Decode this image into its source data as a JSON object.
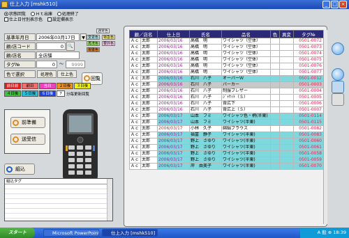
{
  "window": {
    "title": "仕上入力 [mshk510]"
  },
  "options": {
    "radio1": "状態回覧",
    "radio2": "Ｈｔ出庫",
    "radio3": "処理終了",
    "checkbox1": "仕上日付別表示色",
    "checkbox2": "設定欄表示"
  },
  "status_labels": {
    "s1": "通常色",
    "s2": "変更色",
    "s3": "特急色",
    "s4": "再洗色",
    "s5": "要外色",
    "s6": "現書色"
  },
  "form": {
    "base_date_label": "基準年月日",
    "base_date_value": "2006年03月17日",
    "store_code_label": "顧/店コード",
    "store_code_value": "0",
    "store_name_label": "顧/店名",
    "store_name_value": "全店舗",
    "tag_label": "タグ№",
    "tag_from": "0",
    "tag_sep": "～",
    "tag_to": "9999",
    "color_select_label": "色で選択",
    "process_color_label": "処理色",
    "finish_color_label": "仕上色",
    "tuning_label": "回覧"
  },
  "color_buttons": [
    "前日前",
    "前日",
    "当日",
    "２日後",
    "３日後",
    "４日後",
    "５日後",
    "６日後",
    "7"
  ],
  "refresh_note": "分毎更新回覧",
  "buttons": {
    "prev": "前準備",
    "send": "送受信",
    "assemble": "組込"
  },
  "tag_list": {
    "header": "組込タグ"
  },
  "grid": {
    "headers": [
      "顧／店名",
      "仕上日",
      "氏名",
      "品名",
      "色",
      "異変",
      "タグ№"
    ],
    "rows": [
      {
        "cust": "Ａｃ",
        "store": "太郎",
        "date": "2006/03/16",
        "name": "高橋　明",
        "item": "ワイシャツ（空体）",
        "color": "",
        "abn": "",
        "tag": "0501-0072",
        "style": "white"
      },
      {
        "cust": "Ａｃ",
        "store": "太郎",
        "date": "2006/03/16",
        "name": "高橋　明",
        "item": "ワイシャツ（空体）",
        "color": "",
        "abn": "",
        "tag": "0501-0073",
        "style": "white"
      },
      {
        "cust": "Ａｃ",
        "store": "太郎",
        "date": "2006/03/16",
        "name": "高橋　明",
        "item": "ワイシャツ（空体）",
        "color": "",
        "abn": "",
        "tag": "0501-0074",
        "style": "white"
      },
      {
        "cust": "Ａｃ",
        "store": "太郎",
        "date": "2006/03/16",
        "name": "高橋　明",
        "item": "ワイシャツ（空体）",
        "color": "",
        "abn": "",
        "tag": "0501-0075",
        "style": "white"
      },
      {
        "cust": "Ａｃ",
        "store": "太郎",
        "date": "2006/03/16",
        "name": "高橋　明",
        "item": "ワイシャツ（空体）",
        "color": "",
        "abn": "",
        "tag": "0501-0076",
        "style": "white"
      },
      {
        "cust": "Ａｃ",
        "store": "太郎",
        "date": "2006/03/16",
        "name": "高橋　明",
        "item": "ワイシャツ（空体）",
        "color": "",
        "abn": "",
        "tag": "0501-0077",
        "style": "white"
      },
      {
        "cust": "Ａｃ",
        "store": "太郎",
        "date": "2006/03/16",
        "name": "石川　八子",
        "item": "オーバーＷ",
        "color": "",
        "abn": "",
        "tag": "0501-0012",
        "style": "cyan"
      },
      {
        "cust": "Ａｃ",
        "store": "太郎",
        "date": "2006/03/16",
        "name": "石川　八子",
        "item": "パーカー",
        "color": "",
        "abn": "",
        "tag": "0501-0003",
        "style": "gray"
      },
      {
        "cust": "Ａｃ",
        "store": "太郎",
        "date": "2006/03/16",
        "name": "石川　八子",
        "item": "制服ブレザー",
        "color": "",
        "abn": "",
        "tag": "0501-0004",
        "style": "white"
      },
      {
        "cust": "Ａｃ",
        "store": "太郎",
        "date": "2006/03/16",
        "name": "石川　八子",
        "item": "ｼﾞｬｹｯﾄ（Ｓ）",
        "color": "",
        "abn": "",
        "tag": "0501-0005",
        "style": "white"
      },
      {
        "cust": "Ａｃ",
        "store": "太郎",
        "date": "2006/03/16",
        "name": "石川　八子",
        "item": "背広下",
        "color": "",
        "abn": "",
        "tag": "0501-0006",
        "style": "white"
      },
      {
        "cust": "Ａｃ",
        "store": "太郎",
        "date": "2006/03/16",
        "name": "石川　八子",
        "item": "背広上（Ｓ）",
        "color": "",
        "abn": "",
        "tag": "0501-0007",
        "style": "white"
      },
      {
        "cust": "Ａｃ",
        "store": "太郎",
        "date": "2006/03/17",
        "name": "山本　フミ",
        "item": "ワイシャツ色・柄(半東)",
        "color": "",
        "abn": "",
        "tag": "0501-0114",
        "style": "cyan"
      },
      {
        "cust": "Ａｃ",
        "store": "太郎",
        "date": "2006/03/17",
        "name": "山本　フミ",
        "item": "ワイシャツ(半東)",
        "color": "",
        "abn": "",
        "tag": "0501-0115",
        "style": "cyan"
      },
      {
        "cust": "Ａｃ",
        "store": "太郎",
        "date": "2006/03/17",
        "name": "小林　久子",
        "item": "綿絹ブラウス",
        "color": "",
        "abn": "",
        "tag": "0501-0082",
        "style": "white",
        "red": true
      },
      {
        "cust": "Ａｃ",
        "store": "太郎",
        "date": "2006/03/17",
        "name": "福富　静子",
        "item": "ワイシャツ(半東)",
        "color": "",
        "abn": "",
        "tag": "0501-0083",
        "style": "cyan"
      },
      {
        "cust": "Ａｃ",
        "store": "太郎",
        "date": "2006/03/17",
        "name": "野上　さゆり",
        "item": "ワイシャツ(半東)",
        "color": "",
        "abn": "",
        "tag": "0501-0060",
        "style": "cyan"
      },
      {
        "cust": "Ａｃ",
        "store": "太郎",
        "date": "2006/03/17",
        "name": "野上　さゆり",
        "item": "ワイシャツ(半東)",
        "color": "",
        "abn": "",
        "tag": "0501-0061",
        "style": "cyan"
      },
      {
        "cust": "Ａｃ",
        "store": "太郎",
        "date": "2006/03/17",
        "name": "野上　さゆり",
        "item": "ワイシャツ(半東)",
        "color": "",
        "abn": "",
        "tag": "0501-0058",
        "style": "cyan"
      },
      {
        "cust": "Ａｃ",
        "store": "太郎",
        "date": "2006/03/17",
        "name": "野上　さゆり",
        "item": "ワイシャツ(半東)",
        "color": "",
        "abn": "",
        "tag": "0501-0059",
        "style": "cyan"
      },
      {
        "cust": "Ａｃ",
        "store": "太郎",
        "date": "2006/03/17",
        "name": "岸　由美子",
        "item": "ワイシャツ(半東)",
        "color": "",
        "abn": "",
        "tag": "0501-0070",
        "style": "cyan"
      }
    ]
  },
  "taskbar": {
    "start": "スタート",
    "task1": "Microsoft PowerPoint...",
    "task2": "仕上入力 [mshk510]",
    "tray": "A 般 ⊕ 18:39"
  },
  "colors": {
    "grid_header": "#2b2a78",
    "highlight_row": "#7ed9de",
    "tag_text": "#e02050",
    "date_text": "#a020a0"
  }
}
